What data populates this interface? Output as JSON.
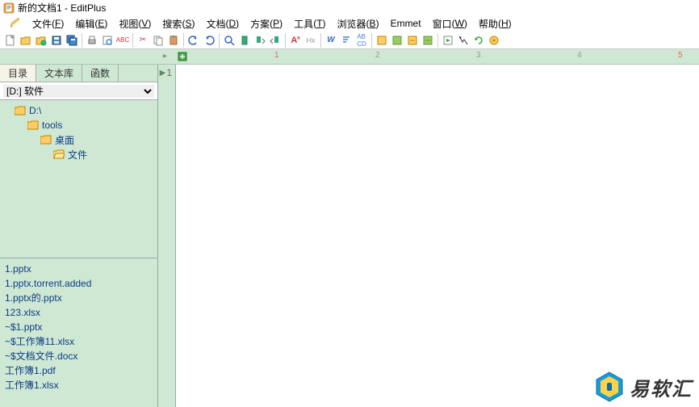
{
  "title_bar": {
    "text": "新的文档1 - EditPlus"
  },
  "menus": {
    "file": {
      "label": "文件",
      "accel": "F"
    },
    "edit": {
      "label": "编辑",
      "accel": "E"
    },
    "view": {
      "label": "视图",
      "accel": "V"
    },
    "search": {
      "label": "搜索",
      "accel": "S"
    },
    "doc": {
      "label": "文档",
      "accel": "D"
    },
    "project": {
      "label": "方案",
      "accel": "P"
    },
    "tools": {
      "label": "工具",
      "accel": "T"
    },
    "browser": {
      "label": "浏览器",
      "accel": "B"
    },
    "emmet": {
      "label": "Emmet",
      "accel": ""
    },
    "window": {
      "label": "窗口",
      "accel": "W"
    },
    "help": {
      "label": "帮助",
      "accel": "H"
    }
  },
  "side_tabs": {
    "t0": "目录",
    "t1": "文本库",
    "t2": "函数"
  },
  "drive_select": {
    "value": "[D:] 软件"
  },
  "tree": {
    "n0": "D:\\",
    "n1": "tools",
    "n2": "桌面",
    "n3": "文件"
  },
  "files": {
    "f0": "1.pptx",
    "f1": "1.pptx.torrent.added",
    "f2": "1.pptx的.pptx",
    "f3": "123.xlsx",
    "f4": "~$1.pptx",
    "f5": "~$工作簿11.xlsx",
    "f6": "~$文档文件.docx",
    "f7": "工作簿1.pdf",
    "f8": "工作簿1.xlsx"
  },
  "editor": {
    "line1": "1"
  },
  "ruler": {
    "m1": "1",
    "m2": "2",
    "m3": "3",
    "m4": "4",
    "m5": "5"
  },
  "watermark": {
    "text": "易软汇"
  },
  "tool_labels": {
    "new": "N",
    "open": "O",
    "save": "S",
    "saveall": "SA",
    "print": "P",
    "preview": "V",
    "cut": "✂",
    "copy": "⧉",
    "paste": "📋",
    "undo": "↶",
    "redo": "↷",
    "find": "🔍",
    "bookmark": "⚑",
    "next": "→",
    "prev": "←",
    "font_a": "A",
    "hex": "Hx",
    "w": "W",
    "sort1": "↕",
    "sort2": "↕",
    "b1": "⬚",
    "b2": "⬚",
    "b3": "⬚",
    "b4": "⬚",
    "play": "▶",
    "rec": "●",
    "stop": "■",
    "cfg": "⚙"
  }
}
